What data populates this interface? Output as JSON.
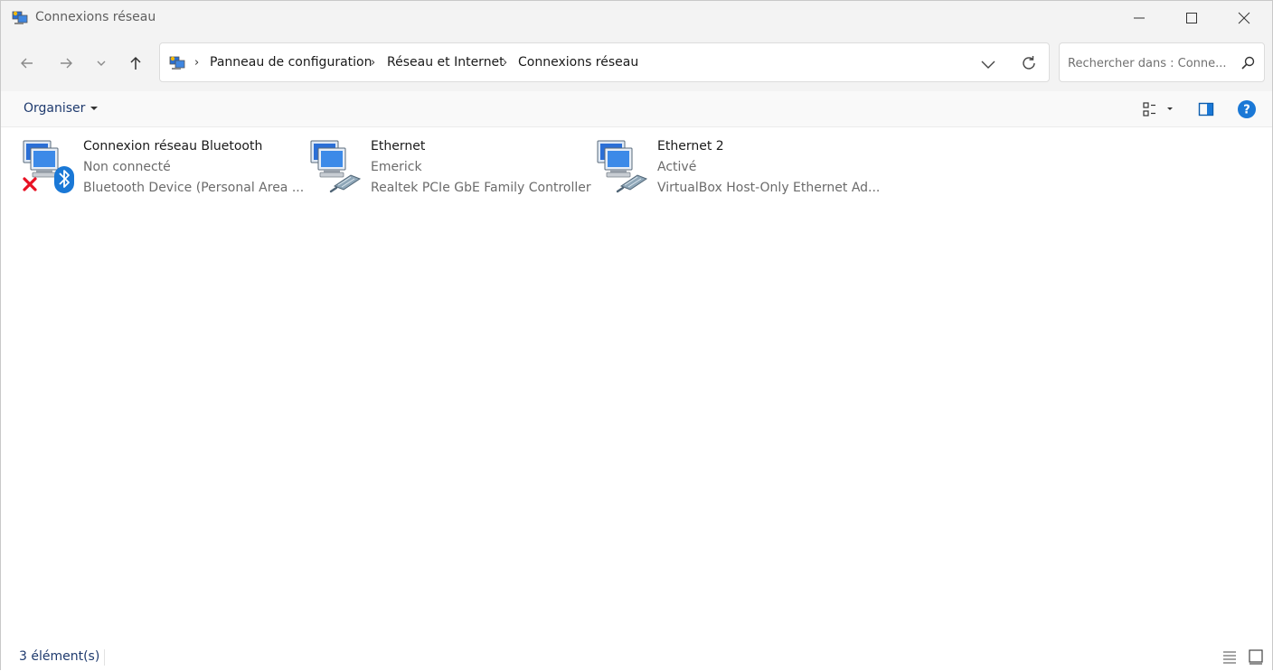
{
  "window": {
    "title": "Connexions réseau"
  },
  "breadcrumb": {
    "items": [
      "Panneau de configuration",
      "Réseau et Internet",
      "Connexions réseau"
    ],
    "separator": "›"
  },
  "search": {
    "placeholder": "Rechercher dans : Conne..."
  },
  "commandbar": {
    "organize_label": "Organiser"
  },
  "connections": [
    {
      "name": "Connexion réseau Bluetooth",
      "status": "Non connecté",
      "device": "Bluetooth Device (Personal Area ...",
      "icon": "bluetooth-network-disconnected-icon"
    },
    {
      "name": "Ethernet",
      "status": "Emerick",
      "device": "Realtek PCIe GbE Family Controller",
      "icon": "ethernet-network-icon"
    },
    {
      "name": "Ethernet 2",
      "status": "Activé",
      "device": "VirtualBox Host-Only Ethernet Ad...",
      "icon": "ethernet-network-icon"
    }
  ],
  "statusbar": {
    "count": "3 élément(s)"
  },
  "colors": {
    "accent": "#0067c0",
    "link_text": "#1e3a6e",
    "secondary_text": "#6b6b6b",
    "error_red": "#e81123",
    "bluetooth_blue": "#1a78d6"
  }
}
